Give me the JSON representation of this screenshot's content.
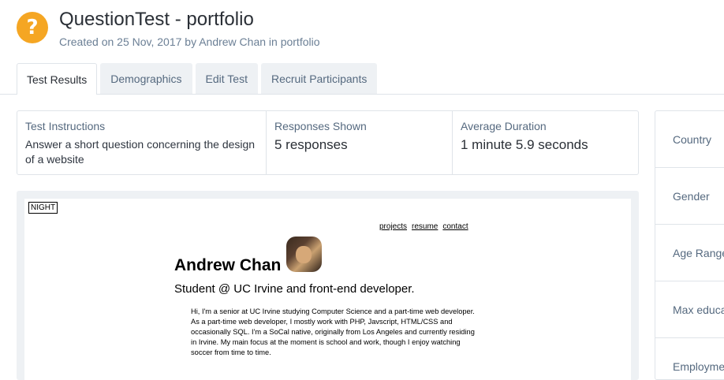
{
  "header": {
    "icon": "question-icon",
    "title": "QuestionTest - portfolio",
    "subtitle": "Created on 25 Nov, 2017 by Andrew Chan in portfolio",
    "accent_color": "#f5a623"
  },
  "tabs": [
    {
      "label": "Test Results",
      "active": true
    },
    {
      "label": "Demographics",
      "active": false
    },
    {
      "label": "Edit Test",
      "active": false
    },
    {
      "label": "Recruit Participants",
      "active": false
    }
  ],
  "stats": {
    "instructions_label": "Test Instructions",
    "instructions_text": "Answer a short question concerning the design of a website",
    "responses_label": "Responses Shown",
    "responses_value": "5 responses",
    "duration_label": "Average Duration",
    "duration_value": "1 minute 5.9 seconds"
  },
  "preview": {
    "night_label": "NIGHT",
    "nav": [
      "projects",
      "resume",
      "contact"
    ],
    "name": "Andrew Chan",
    "tagline": "Student @ UC Irvine and front-end developer.",
    "bio": "Hi, I'm a senior at UC Irvine studying Computer Science and a part-time web developer. As a part-time web developer, I mostly work with PHP, Javscript, HTML/CSS and occasionally SQL. I'm a SoCal native, originally from Los Angeles and currently residing in Irvine. My main focus at the moment is school and work, though I enjoy watching soccer from time to time."
  },
  "filters": [
    "Country",
    "Gender",
    "Age Range",
    "Max educa",
    "Employme"
  ]
}
